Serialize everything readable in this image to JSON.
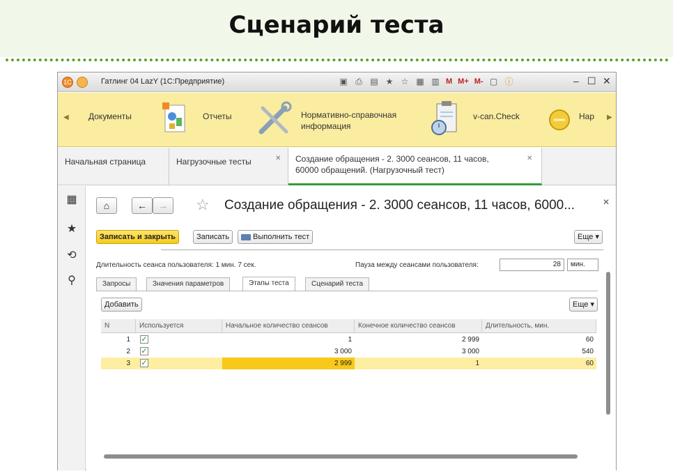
{
  "slide": {
    "title": "Сценарий теста"
  },
  "window": {
    "title": "Гатлинг 04 LazY  (1С:Предприятие)",
    "toolbar_m": [
      "M",
      "M+",
      "M-"
    ]
  },
  "sections": {
    "items": [
      {
        "label": "Документы"
      },
      {
        "label": "Отчеты"
      },
      {
        "label": "Нормативно-справочная",
        "label2": "информация"
      },
      {
        "label": "v-can.Check"
      },
      {
        "label": "Нар"
      }
    ]
  },
  "tabs": [
    {
      "label": "Начальная страница"
    },
    {
      "label": "Нагрузочные тесты"
    },
    {
      "label": "Создание обращения - 2. 3000 сеансов, 11 часов,",
      "label2": "60000 обращений. (Нагрузочный тест)"
    }
  ],
  "form": {
    "title": "Создание обращения - 2. 3000 сеансов, 11 часов, 6000...",
    "buttons": {
      "save_close": "Записать и закрыть",
      "save": "Записать",
      "run": "Выполнить тест",
      "more": "Еще"
    },
    "session_duration": "Длительность сеанса пользователя: 1 мин. 7 сек.",
    "pause_label": "Пауза между сеансами пользователя:",
    "pause_value": "28",
    "pause_unit": "мин.",
    "form_tabs": [
      "Запросы",
      "Значения параметров",
      "Этапы теста",
      "Сценарий теста"
    ],
    "add_button": "Добавить",
    "table_more": "Еще",
    "columns": [
      "N",
      "Используется",
      "Начальное количество сеансов",
      "Конечное количество сеансов",
      "Длительность, мин."
    ],
    "rows": [
      {
        "n": "1",
        "used": true,
        "start": "1",
        "end": "2 999",
        "duration": "60"
      },
      {
        "n": "2",
        "used": true,
        "start": "3 000",
        "end": "3 000",
        "duration": "540"
      },
      {
        "n": "3",
        "used": true,
        "start": "2 999",
        "end": "1",
        "duration": "60"
      }
    ]
  }
}
